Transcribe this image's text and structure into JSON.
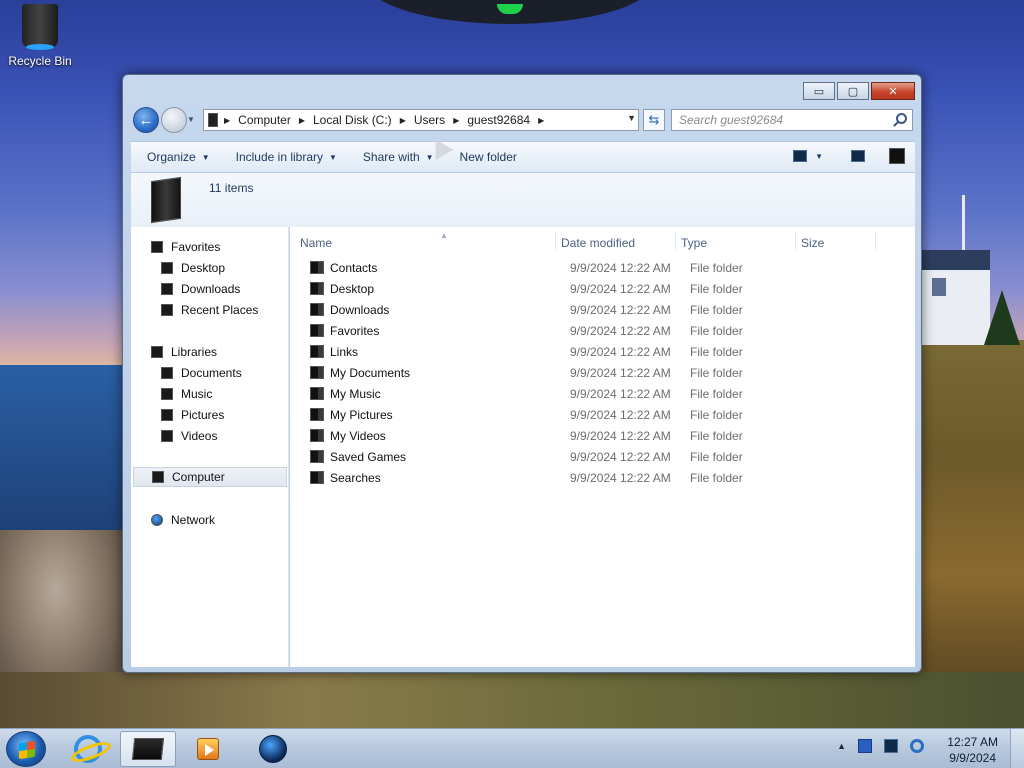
{
  "desktop": {
    "icons": [
      {
        "label": "Recycle Bin",
        "icon": "recycle-bin-icon"
      }
    ]
  },
  "window": {
    "caption": {
      "minimize": "▭",
      "maximize": "▢",
      "close": "✕"
    },
    "address": {
      "segments": [
        "Computer",
        "Local Disk (C:)",
        "Users",
        "guest92684"
      ]
    },
    "search": {
      "placeholder": "Search guest92684"
    },
    "toolbar": {
      "organize": "Organize",
      "include_in_library": "Include in library",
      "share_with": "Share with",
      "new_folder": "New folder"
    },
    "details": {
      "item_count": "11 items"
    },
    "nav_pane": {
      "favorites": {
        "label": "Favorites",
        "items": [
          "Desktop",
          "Downloads",
          "Recent Places"
        ]
      },
      "libraries": {
        "label": "Libraries",
        "items": [
          "Documents",
          "Music",
          "Pictures",
          "Videos"
        ]
      },
      "computer": "Computer",
      "network": "Network"
    },
    "columns": {
      "name": "Name",
      "date_modified": "Date modified",
      "type": "Type",
      "size": "Size"
    },
    "files": [
      {
        "name": "Contacts",
        "date": "9/9/2024 12:22 AM",
        "type": "File folder"
      },
      {
        "name": "Desktop",
        "date": "9/9/2024 12:22 AM",
        "type": "File folder"
      },
      {
        "name": "Downloads",
        "date": "9/9/2024 12:22 AM",
        "type": "File folder"
      },
      {
        "name": "Favorites",
        "date": "9/9/2024 12:22 AM",
        "type": "File folder"
      },
      {
        "name": "Links",
        "date": "9/9/2024 12:22 AM",
        "type": "File folder"
      },
      {
        "name": "My Documents",
        "date": "9/9/2024 12:22 AM",
        "type": "File folder"
      },
      {
        "name": "My Music",
        "date": "9/9/2024 12:22 AM",
        "type": "File folder"
      },
      {
        "name": "My Pictures",
        "date": "9/9/2024 12:22 AM",
        "type": "File folder"
      },
      {
        "name": "My Videos",
        "date": "9/9/2024 12:22 AM",
        "type": "File folder"
      },
      {
        "name": "Saved Games",
        "date": "9/9/2024 12:22 AM",
        "type": "File folder"
      },
      {
        "name": "Searches",
        "date": "9/9/2024 12:22 AM",
        "type": "File folder"
      }
    ]
  },
  "taskbar": {
    "pinned": [
      "start-button",
      "internet-explorer-icon",
      "windows-explorer-icon",
      "media-player-icon",
      "globe-icon"
    ],
    "clock": {
      "time": "12:27 AM",
      "date": "9/9/2024"
    }
  }
}
